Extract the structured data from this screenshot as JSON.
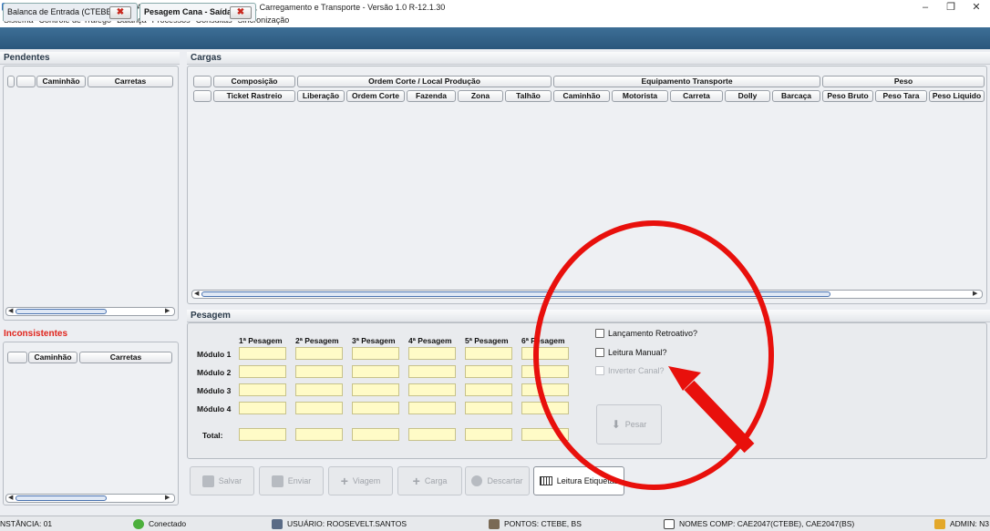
{
  "window": {
    "title": "SPA_OFF - Sistema de Pesagem Automatica Offline - CCT - Corte, Carregamento e Transporte - Versão 1.0 R-12.1.30"
  },
  "menu": [
    "Sistema",
    "Controle de Tráfego",
    "Balança",
    "Processos",
    "Consultas",
    "Sincronização"
  ],
  "tabs": [
    {
      "label": "Balanca de Entrada (CTEBE)"
    },
    {
      "label": "Pesagem Cana - Saída"
    }
  ],
  "pendentes": {
    "title": "Pendentes",
    "columns": [
      "Caminhão",
      "Carretas"
    ]
  },
  "inconsistentes": {
    "title": "Inconsistentes",
    "columns": [
      "Caminhão",
      "Carretas"
    ]
  },
  "cargas": {
    "title": "Cargas",
    "groups": [
      "Composição",
      "Ordem Corte / Local Produção",
      "Equipamento Transporte",
      "Peso"
    ],
    "columns": [
      "Ticket Rastreio",
      "Liberação",
      "Ordem Corte",
      "Fazenda",
      "Zona",
      "Talhão",
      "Caminhão",
      "Motorista",
      "Carreta",
      "Dolly",
      "Barcaça",
      "Peso Bruto",
      "Peso Tara",
      "Peso Liquido"
    ]
  },
  "pesagem": {
    "title": "Pesagem",
    "columns": [
      "1ª Pesagem",
      "2ª Pesagem",
      "3ª Pesagem",
      "4ª Pesagem",
      "5ª Pesagem",
      "6ª Pesagem"
    ],
    "rows": [
      "Módulo 1",
      "Módulo 2",
      "Módulo 3",
      "Módulo 4"
    ],
    "total_label": "Total:",
    "options": {
      "retroativo": "Lançamento Retroativo?",
      "manual": "Leitura Manual?",
      "inverter": "Inverter Canal?"
    },
    "pesar": "Pesar"
  },
  "actions": {
    "salvar": "Salvar",
    "enviar": "Enviar",
    "viagem": "Viagem",
    "carga": "Carga",
    "descartar": "Descartar",
    "leitura": "Leitura Etiquetas"
  },
  "status": {
    "instancia": "NSTÂNCIA: 01",
    "conexao": "Conectado",
    "usuario": "USUÁRIO: ROOSEVELT.SANTOS",
    "pontos": "PONTOS: CTEBE, BS",
    "nomes": "NOMES COMP: CAE2047(CTEBE), CAE2047(BS)",
    "admin": "ADMIN: N3"
  },
  "annotation_color": "#e8100c"
}
